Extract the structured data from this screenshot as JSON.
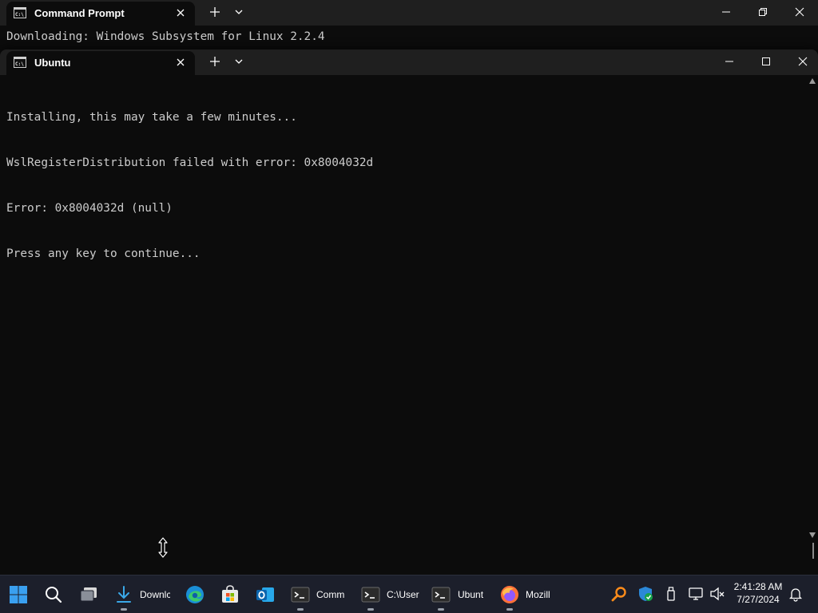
{
  "back_window": {
    "tab_title": "Command Prompt",
    "terminal_line": "Downloading: Windows Subsystem for Linux 2.2.4"
  },
  "front_window": {
    "tab_title": "Ubuntu",
    "terminal_lines": [
      "Installing, this may take a few minutes...",
      "WslRegisterDistribution failed with error: 0x8004032d",
      "Error: 0x8004032d (null)",
      "Press any key to continue..."
    ]
  },
  "taskbar": {
    "items": [
      {
        "label": "Downlc",
        "icon": "download-icon"
      },
      {
        "label": "Comm",
        "icon": "terminal-icon"
      },
      {
        "label": "C:\\User",
        "icon": "terminal-icon"
      },
      {
        "label": "Ubunt",
        "icon": "terminal-icon"
      },
      {
        "label": "Mozill",
        "icon": "firefox-icon"
      }
    ],
    "clock": {
      "time": "2:41:28 AM",
      "date": "7/27/2024"
    }
  },
  "colors": {
    "terminal_bg": "#0c0c0c",
    "terminal_fg": "#cccccc",
    "tabbar_bg": "#1f1f1f",
    "taskbar_bg": "#1c1f2b",
    "windows_blue": "#0078d4"
  }
}
